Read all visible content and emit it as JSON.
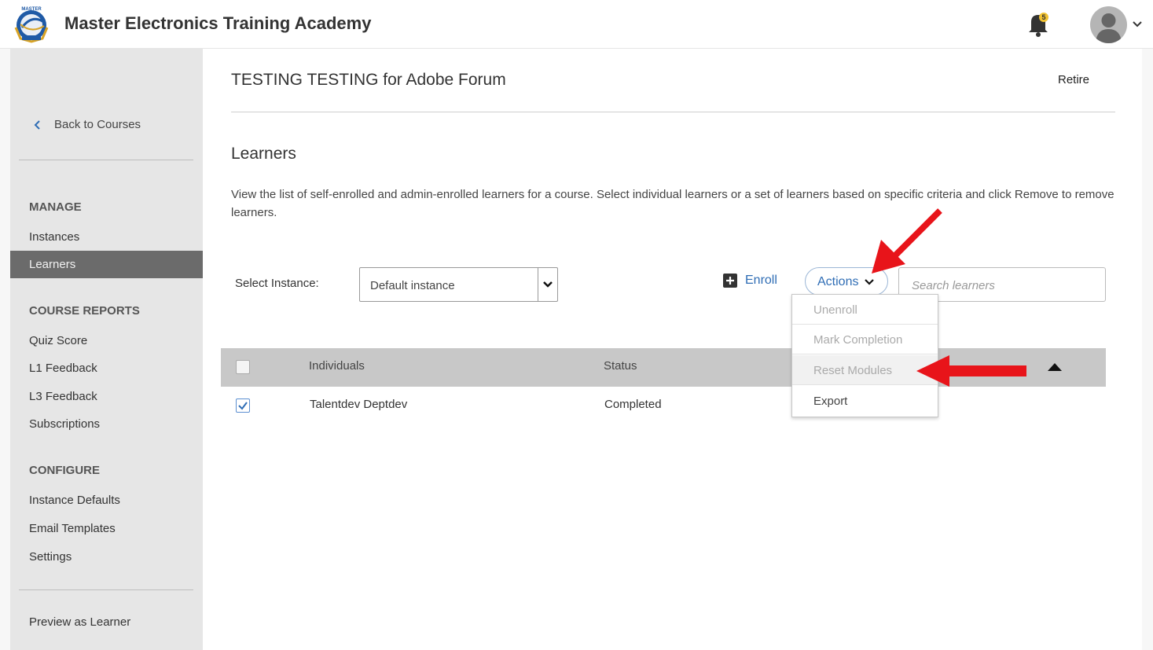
{
  "header": {
    "app_title": "Master Electronics Training Academy",
    "notification_count": "5",
    "logo_text": "MASTER"
  },
  "sidebar": {
    "back_label": "Back to Courses",
    "manage_heading": "MANAGE",
    "manage_items": [
      "Instances",
      "Learners"
    ],
    "active_item": "Learners",
    "reports_heading": "COURSE REPORTS",
    "reports_items": [
      "Quiz Score",
      "L1 Feedback",
      "L3 Feedback",
      "Subscriptions"
    ],
    "configure_heading": "CONFIGURE",
    "configure_items": [
      "Instance Defaults",
      "Email Templates",
      "Settings"
    ],
    "preview_label": "Preview as Learner"
  },
  "main": {
    "course_title": "TESTING TESTING for Adobe Forum",
    "retire_label": "Retire",
    "section_title": "Learners",
    "description": "View the list of self-enrolled and admin-enrolled learners for a course. Select individual learners or a set of learners based on specific criteria and click Remove to remove learners.",
    "select_instance_label": "Select Instance:",
    "select_instance_value": "Default instance",
    "enroll_label": "Enroll",
    "actions_label": "Actions",
    "search_placeholder": "Search learners",
    "table": {
      "columns": [
        "Individuals",
        "Status"
      ],
      "rows": [
        {
          "name": "Talentdev Deptdev",
          "status": "Completed",
          "checked": true
        }
      ]
    },
    "actions_menu": {
      "items": [
        "Unenroll",
        "Mark Completion",
        "Reset Modules",
        "Export"
      ],
      "hovered": "Reset Modules",
      "enabled": [
        "Export"
      ]
    }
  },
  "colors": {
    "accent_blue": "#2f6db5",
    "sidebar_bg": "#e6e6e6",
    "sidebar_active": "#6b6b6b",
    "table_header": "#c8c8c8",
    "annotation_red": "#e8141a"
  }
}
